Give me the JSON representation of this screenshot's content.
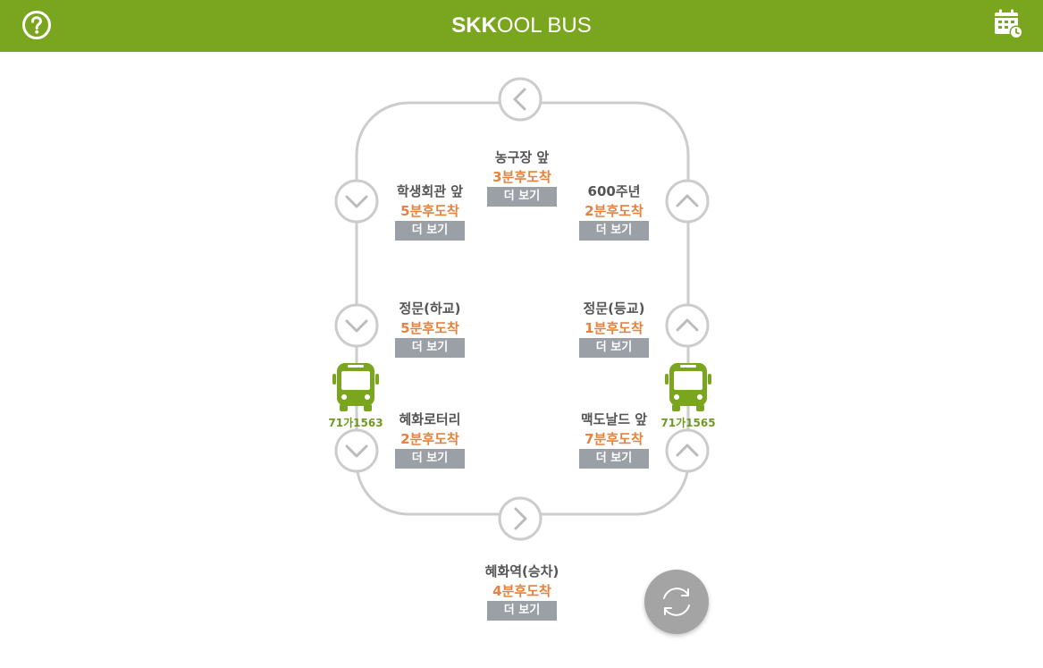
{
  "header": {
    "title_bold": "SKK",
    "title_rest": "OOL BUS",
    "help_icon": "help-circle-icon",
    "schedule_icon": "calendar-clock-icon"
  },
  "colors": {
    "brand": "#7aa51e",
    "eta": "#e6823c",
    "route_line": "#cccccc",
    "button": "#9aa0a6",
    "bus": "#7aa51e",
    "refresh": "#a4a4a4"
  },
  "more_label": "더 보기",
  "stops": {
    "top": {
      "name": "농구장 앞",
      "eta": "3분후도착"
    },
    "left1": {
      "name": "학생회관 앞",
      "eta": "5분후도착"
    },
    "left2": {
      "name": "정문(하교)",
      "eta": "5분후도착"
    },
    "left3": {
      "name": "혜화로터리",
      "eta": "2분후도착"
    },
    "right1": {
      "name": "600주년",
      "eta": "2분후도착"
    },
    "right2": {
      "name": "정문(등교)",
      "eta": "1분후도착"
    },
    "right3": {
      "name": "맥도날드 앞",
      "eta": "7분후도착"
    },
    "bottom": {
      "name": "혜화역(승차)",
      "eta": "4분후도착"
    }
  },
  "buses": [
    {
      "plate": "71가1563",
      "side": "left"
    },
    {
      "plate": "71가1565",
      "side": "right"
    }
  ],
  "icons": {
    "direction_top": "chevron-left-icon",
    "direction_bottom": "chevron-right-icon",
    "direction_left": "chevron-down-icon",
    "direction_right": "chevron-up-icon",
    "bus": "bus-icon",
    "refresh": "refresh-icon"
  }
}
